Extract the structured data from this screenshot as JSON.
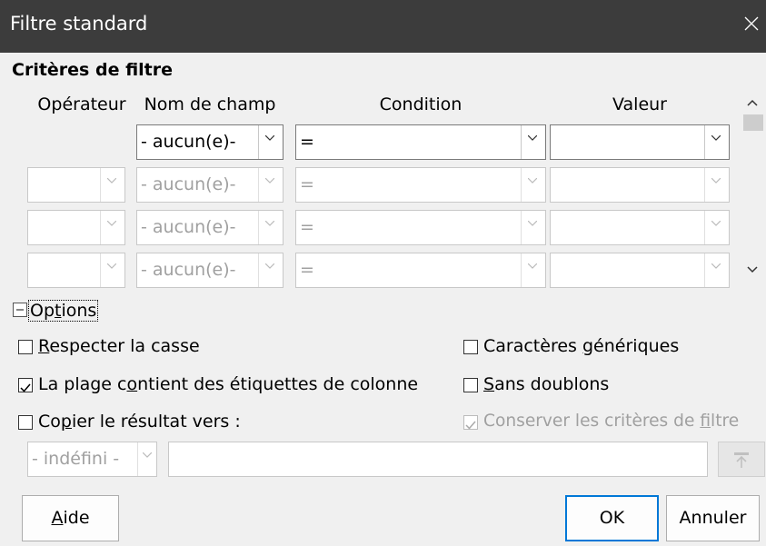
{
  "window": {
    "title": "Filtre standard"
  },
  "criteria": {
    "section_label": "Critères de filtre",
    "headers": {
      "operator": "Opérateur",
      "field": "Nom de champ",
      "condition": "Condition",
      "value": "Valeur"
    },
    "rows": [
      {
        "operator": "",
        "field": "- aucun(e)-",
        "condition": "=",
        "value": "",
        "enabled": true
      },
      {
        "operator": "",
        "field": "- aucun(e)-",
        "condition": "=",
        "value": "",
        "enabled": false
      },
      {
        "operator": "",
        "field": "- aucun(e)-",
        "condition": "=",
        "value": "",
        "enabled": false
      },
      {
        "operator": "",
        "field": "- aucun(e)-",
        "condition": "=",
        "value": "",
        "enabled": false
      }
    ]
  },
  "options": {
    "toggle": {
      "before": "Op",
      "mnemonic": "t",
      "after": "ions",
      "expanded": true
    },
    "case_sensitive": {
      "before": "",
      "mnemonic": "R",
      "after": "especter la casse",
      "checked": false
    },
    "has_headers": {
      "before": "La plage c",
      "mnemonic": "o",
      "after": "ntient des étiquettes de colonne",
      "checked": true
    },
    "copy_results": {
      "before": "Co",
      "mnemonic": "p",
      "after": "ier le résultat vers :",
      "checked": false
    },
    "wildcards": {
      "before": "Caractères ",
      "mnemonic": "g",
      "after": "énériques",
      "checked": false
    },
    "no_duplicates": {
      "before": "",
      "mnemonic": "S",
      "after": "ans doublons",
      "checked": false
    },
    "keep_criteria": {
      "before": "Conserver les critères de ",
      "mnemonic": "f",
      "after": "iltre",
      "checked": true,
      "enabled": false
    },
    "copy_target": {
      "selected": "- indéfini -",
      "value": ""
    }
  },
  "buttons": {
    "help": {
      "mnemonic": "A",
      "after": "ide"
    },
    "ok": "OK",
    "cancel": "Annuler"
  },
  "colors": {
    "titlebar": "#3c3c3c",
    "dialog_bg": "#f0f0f0",
    "accent": "#0078d7"
  }
}
